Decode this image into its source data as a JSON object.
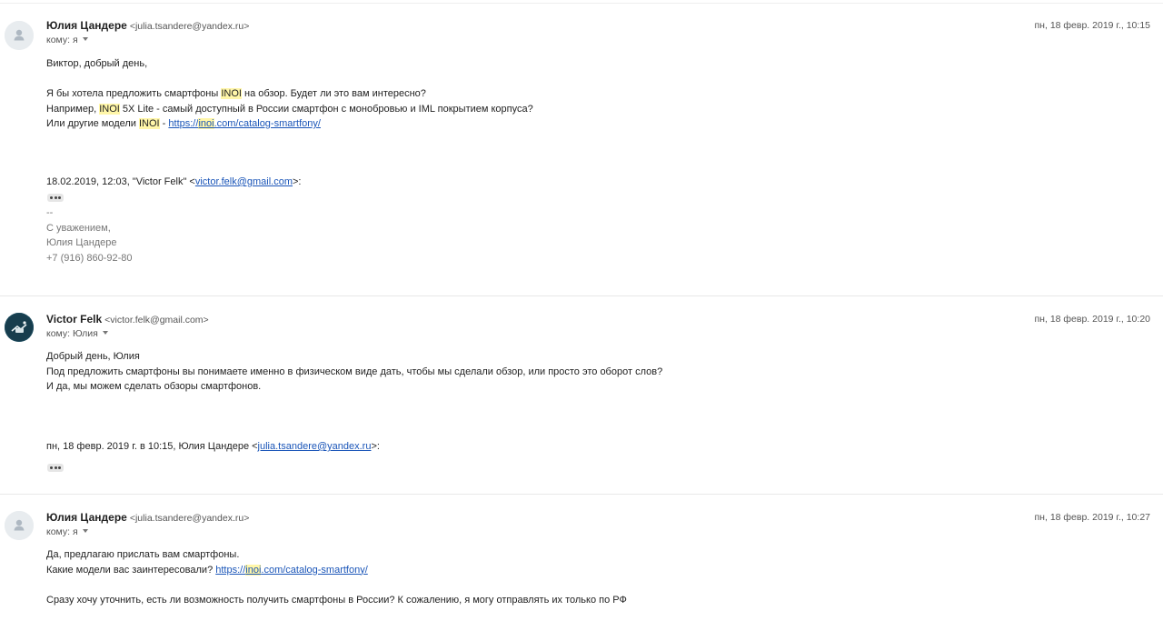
{
  "messages": [
    {
      "sender_name": "Юлия Цандере",
      "sender_email": "<julia.tsandere@yandex.ru>",
      "date": "пн, 18 февр. 2019 г., 10:15",
      "to": "кому: я",
      "greeting": "Виктор, добрый день,",
      "line1_pre": "Я бы хотела предложить смартфоны ",
      "line1_hl": "INOI",
      "line1_post": " на обзор. Будет ли это вам интересно?",
      "line2_pre": "Например, ",
      "line2_hl": "INOI",
      "line2_post": " 5X Lite - самый доступный в России смартфон с монобровью и IML покрытием корпуса?",
      "line3_pre": "Или другие модели ",
      "line3_hl": "INOI",
      "line3_mid": " - ",
      "link_pre": "https://",
      "link_hl": "inoi",
      "link_post": ".com/catalog-smartfony/",
      "quote_pre": "18.02.2019, 12:03, \"Victor Felk\" <",
      "quote_link": "victor.felk@gmail.com",
      "quote_post": ">:",
      "sig_dash": "--",
      "sig_regards": "С уважением,",
      "sig_name": "Юлия Цандере",
      "sig_phone": "+7 (916) 860-92-80"
    },
    {
      "sender_name": "Victor Felk",
      "sender_email": "<victor.felk@gmail.com>",
      "date": "пн, 18 февр. 2019 г., 10:20",
      "to": "кому: Юлия",
      "line1": "Добрый день, Юлия",
      "line2": "Под предложить смартфоны вы понимаете именно в физическом виде дать, чтобы мы сделали обзор, или просто это оборот слов?",
      "line3": "И да, мы можем сделать обзоры смартфонов.",
      "quote_pre": "пн, 18 февр. 2019 г. в 10:15, Юлия Цандере <",
      "quote_link": "julia.tsandere@yandex.ru",
      "quote_post": ">:"
    },
    {
      "sender_name": "Юлия Цандере",
      "sender_email": "<julia.tsandere@yandex.ru>",
      "date": "пн, 18 февр. 2019 г., 10:27",
      "to": "кому: я",
      "line1": "Да, предлагаю прислать вам смартфоны.",
      "line2_pre": "Какие модели вас заинтересовали? ",
      "link_pre": "https://",
      "link_hl": "inoi",
      "link_post": ".com/catalog-smartfony/",
      "line3": "Сразу хочу уточнить, есть ли возможность получить смартфоны в России? К сожалению, я могу отправлять их только по РФ"
    }
  ],
  "colors": {
    "highlight": "#fff6a8",
    "link": "#1a55b8",
    "avatar_dark": "#1d4a5c"
  }
}
